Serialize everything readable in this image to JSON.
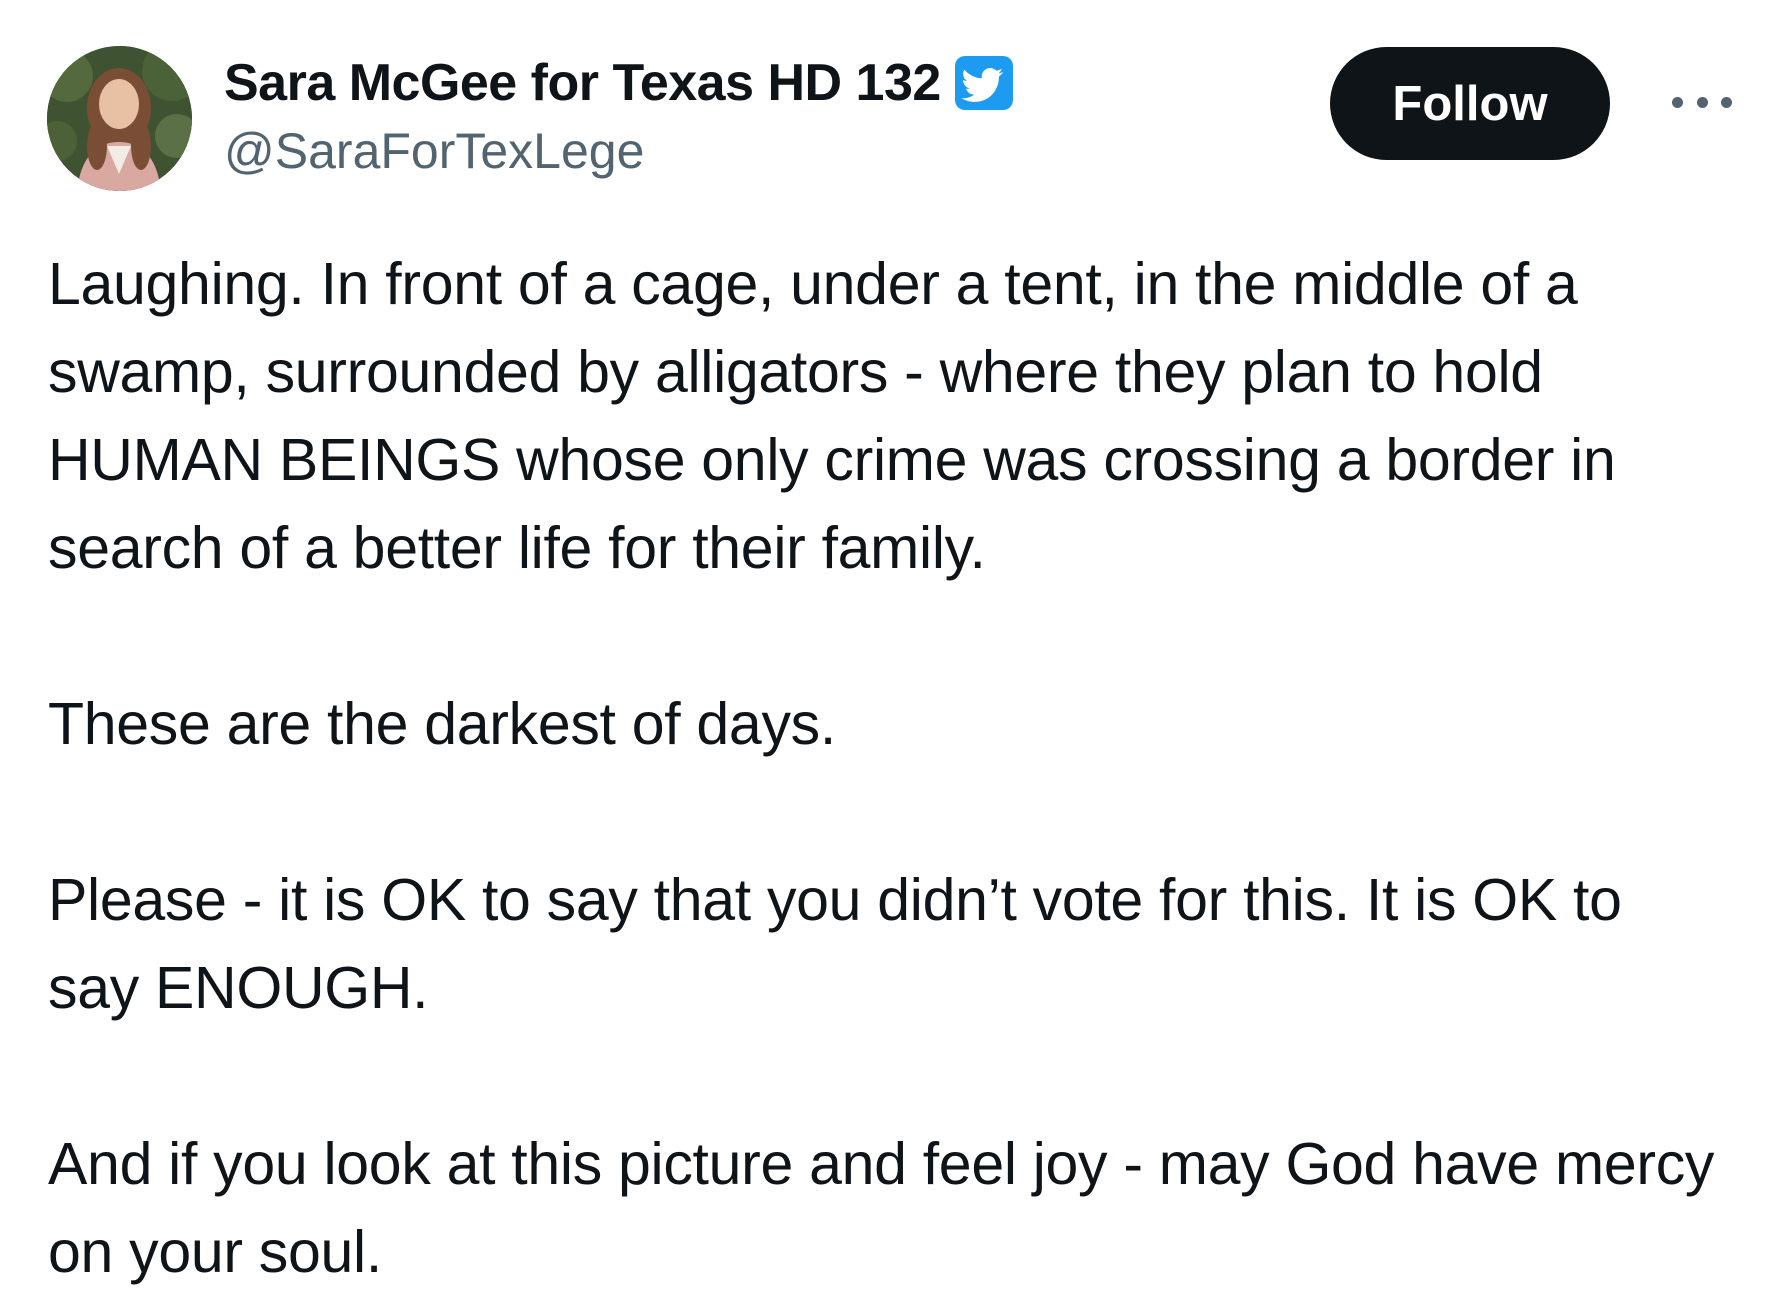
{
  "author": {
    "display_name": "Sara McGee for Texas HD 132",
    "handle": "@SaraForTexLege",
    "verified_icon": "twitter-bird-verified-badge",
    "avatar_icon": "profile-photo"
  },
  "actions": {
    "follow_label": "Follow",
    "more_icon": "ellipsis-icon"
  },
  "tweet": {
    "paragraphs": [
      "Laughing. In front of a cage, under a tent, in the middle of a swamp, surrounded by alligators - where they plan to hold HUMAN BEINGS whose only crime was crossing a border in search of a better life for their family.",
      "These are the darkest of days.",
      "Please - it is OK to say that you didn’t vote for this. It is OK to say ENOUGH.",
      "And if you look at this picture and feel joy - may God have mercy on your soul."
    ]
  },
  "colors": {
    "text": "#0f1419",
    "secondary_text": "#536471",
    "follow_bg": "#0f1419",
    "follow_text": "#ffffff",
    "verified_blue": "#1d9bf0"
  }
}
